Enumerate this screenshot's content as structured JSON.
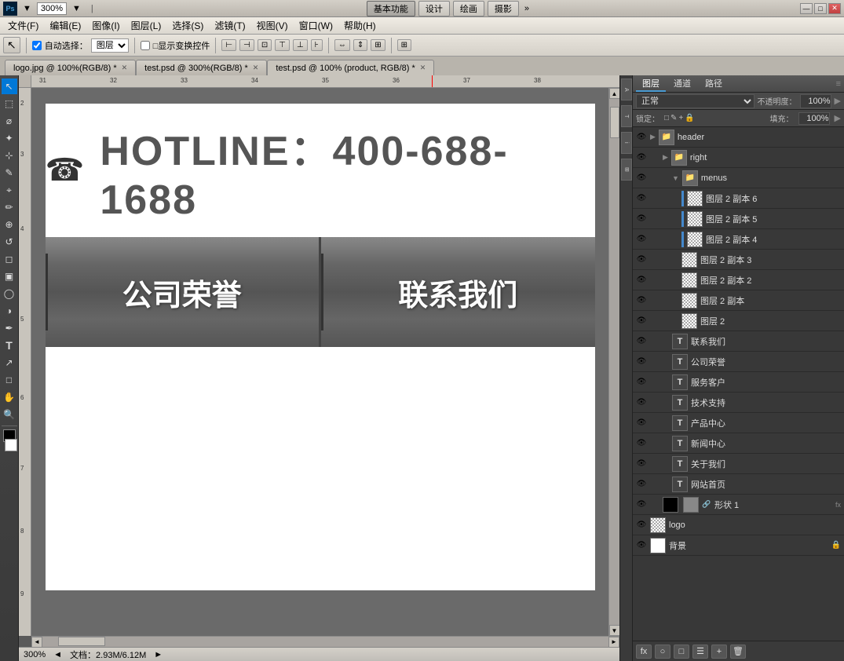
{
  "titlebar": {
    "ps_logo": "Ps",
    "zoom": "300%",
    "mode_buttons": [
      "基本功能",
      "设计",
      "绘画",
      "摄影"
    ],
    "active_mode": "基本功能",
    "expand": "»",
    "win_buttons": [
      "—",
      "□",
      "✕"
    ]
  },
  "menubar": {
    "items": [
      "文件(F)",
      "编辑(E)",
      "图像(I)",
      "图层(L)",
      "选择(S)",
      "滤镜(T)",
      "视图(V)",
      "窗口(W)",
      "帮助(H)"
    ]
  },
  "optionsbar": {
    "tool_icon": "↖",
    "checkbox_label": "自动选择：",
    "select_value": "图层",
    "checkbox2_label": "□显示变换控件",
    "align_icons": [
      "←→",
      "↕",
      "⊡",
      "⊞",
      "↔",
      "⇔",
      "⇕",
      "⊤",
      "⊥"
    ],
    "extra_icon": "⊞"
  },
  "tabs": [
    {
      "label": "logo.jpg @ 100%(RGB/8) *",
      "active": false
    },
    {
      "label": "test.psd @ 300%(RGB/8) *",
      "active": false
    },
    {
      "label": "test.psd @ 100% (product, RGB/8) *",
      "active": true
    }
  ],
  "canvas": {
    "hotline_phone_icon": "☎",
    "hotline_text": "HOTLINE：400-688-1688",
    "menu_items": [
      "公司荣誉",
      "联系我们"
    ]
  },
  "statusbar": {
    "zoom": "300%",
    "doc_size": "文档：2.93M/6.12M",
    "arrows": [
      "◄",
      "►"
    ]
  },
  "layers_panel": {
    "tabs": [
      "图层",
      "通道",
      "路径"
    ],
    "active_tab": "图层",
    "blend_mode": "正常",
    "opacity_label": "不透明度：",
    "opacity_value": "100%",
    "lock_label": "锁定：",
    "lock_icons": [
      "□",
      "✎",
      "＋",
      "🔒"
    ],
    "fill_label": "填充：",
    "fill_value": "100%",
    "layers": [
      {
        "id": 1,
        "name": "header",
        "type": "group",
        "indent": 0,
        "visible": true,
        "thumb": "folder",
        "expanded": true
      },
      {
        "id": 2,
        "name": "right",
        "type": "group",
        "indent": 1,
        "visible": true,
        "thumb": "folder",
        "expanded": true
      },
      {
        "id": 3,
        "name": "menus",
        "type": "group",
        "indent": 2,
        "visible": true,
        "thumb": "folder",
        "expanded": true
      },
      {
        "id": 4,
        "name": "图层 2 副本 6",
        "type": "layer",
        "indent": 3,
        "visible": true,
        "thumb": "checker",
        "blueline": true
      },
      {
        "id": 5,
        "name": "图层 2 副本 5",
        "type": "layer",
        "indent": 3,
        "visible": true,
        "thumb": "checker",
        "blueline": true
      },
      {
        "id": 6,
        "name": "图层 2 副本 4",
        "type": "layer",
        "indent": 3,
        "visible": true,
        "thumb": "checker",
        "blueline": true
      },
      {
        "id": 7,
        "name": "图层 2 副本 3",
        "type": "layer",
        "indent": 3,
        "visible": true,
        "thumb": "checker"
      },
      {
        "id": 8,
        "name": "图层 2 副本 2",
        "type": "layer",
        "indent": 3,
        "visible": true,
        "thumb": "checker"
      },
      {
        "id": 9,
        "name": "图层 2 副本",
        "type": "layer",
        "indent": 3,
        "visible": true,
        "thumb": "checker"
      },
      {
        "id": 10,
        "name": "图层 2",
        "type": "layer",
        "indent": 3,
        "visible": true,
        "thumb": "checker",
        "blueline": false
      },
      {
        "id": 11,
        "name": "联系我们",
        "type": "text",
        "indent": 2,
        "visible": true,
        "thumb": "text"
      },
      {
        "id": 12,
        "name": "公司荣誉",
        "type": "text",
        "indent": 2,
        "visible": true,
        "thumb": "text"
      },
      {
        "id": 13,
        "name": "服务客户",
        "type": "text",
        "indent": 2,
        "visible": true,
        "thumb": "text"
      },
      {
        "id": 14,
        "name": "技术支持",
        "type": "text",
        "indent": 2,
        "visible": true,
        "thumb": "text"
      },
      {
        "id": 15,
        "name": "产品中心",
        "type": "text",
        "indent": 2,
        "visible": true,
        "thumb": "text"
      },
      {
        "id": 16,
        "name": "新闻中心",
        "type": "text",
        "indent": 2,
        "visible": true,
        "thumb": "text"
      },
      {
        "id": 17,
        "name": "关于我们",
        "type": "text",
        "indent": 2,
        "visible": true,
        "thumb": "text"
      },
      {
        "id": 18,
        "name": "网站首页",
        "type": "text",
        "indent": 2,
        "visible": true,
        "thumb": "text"
      },
      {
        "id": 19,
        "name": "形状 1",
        "type": "shape",
        "indent": 1,
        "visible": true,
        "thumb": "black",
        "fx": true
      },
      {
        "id": 20,
        "name": "logo",
        "type": "layer",
        "indent": 0,
        "visible": true,
        "thumb": "checker"
      },
      {
        "id": 21,
        "name": "背景",
        "type": "layer",
        "indent": 0,
        "visible": true,
        "thumb": "white",
        "locked": true
      }
    ],
    "bottom_buttons": [
      "fx",
      "○",
      "□",
      "☰",
      "🗑"
    ]
  },
  "right_mini_toolbar": {
    "buttons": [
      "▲",
      "▼"
    ]
  },
  "left_toolbar": {
    "tools": [
      "↖",
      "✂",
      "⬡",
      "✏",
      "🪣",
      "T",
      "↗",
      "🔍",
      "☰",
      "🔲",
      "🎨"
    ]
  }
}
